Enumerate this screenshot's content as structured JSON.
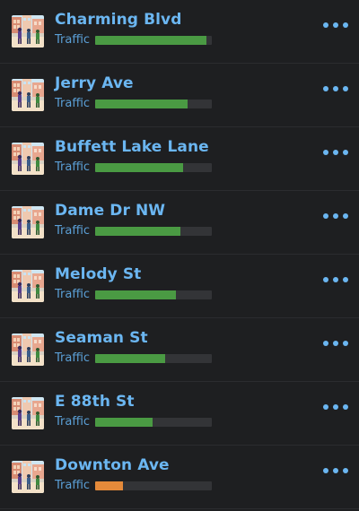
{
  "streets": [
    {
      "name": "Charming Blvd",
      "traffic_label": "Traffic",
      "traffic_level": 0.95,
      "bar_color": "#4a9a43"
    },
    {
      "name": "Jerry Ave",
      "traffic_label": "Traffic",
      "traffic_level": 0.79,
      "bar_color": "#4a9a43"
    },
    {
      "name": "Buffett Lake Lane",
      "traffic_label": "Traffic",
      "traffic_level": 0.75,
      "bar_color": "#4a9a43"
    },
    {
      "name": "Dame Dr NW",
      "traffic_label": "Traffic",
      "traffic_level": 0.73,
      "bar_color": "#4a9a43"
    },
    {
      "name": "Melody St",
      "traffic_label": "Traffic",
      "traffic_level": 0.69,
      "bar_color": "#4a9a43"
    },
    {
      "name": "Seaman St",
      "traffic_label": "Traffic",
      "traffic_level": 0.6,
      "bar_color": "#4a9a43"
    },
    {
      "name": "E 88th St",
      "traffic_label": "Traffic",
      "traffic_level": 0.49,
      "bar_color": "#4a9a43"
    },
    {
      "name": "Downton Ave",
      "traffic_label": "Traffic",
      "traffic_level": 0.24,
      "bar_color": "#e58a3a"
    }
  ],
  "icons": {
    "street_thumbnail": "street-scene-icon",
    "more": "more-options-icon"
  }
}
